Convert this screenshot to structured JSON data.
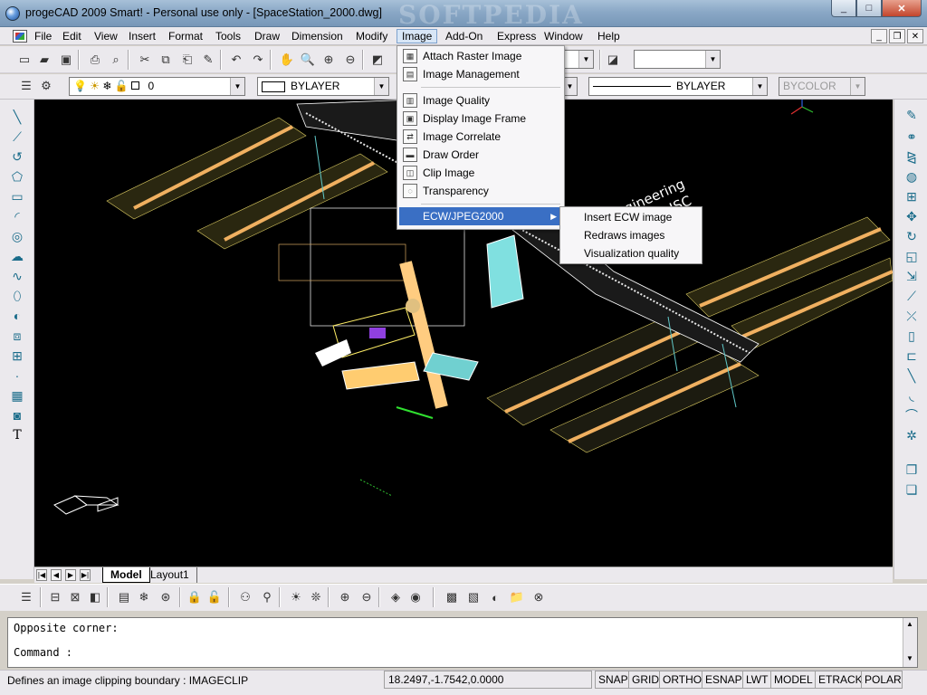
{
  "window": {
    "title": "progeCAD 2009 Smart! - Personal use only - [SpaceStation_2000.dwg]",
    "watermark": "SOFTPEDIA",
    "minimize": "_",
    "maximize": "□",
    "close": "✕"
  },
  "menubar": {
    "items": [
      "File",
      "Edit",
      "View",
      "Insert",
      "Format",
      "Tools",
      "Draw",
      "Dimension",
      "Modify",
      "Image",
      "Add-On",
      "Express",
      "Window",
      "Help"
    ],
    "active": "Image"
  },
  "toolbar2": {
    "layer_value": "0",
    "color_value": "BYLAYER",
    "linetype_value": "BYLAYER",
    "lineweight_value": "BYCOLOR"
  },
  "image_menu": {
    "items": [
      {
        "label": "Attach Raster Image",
        "icon": "attach-raster-icon"
      },
      {
        "label": "Image Management",
        "icon": "image-management-icon"
      },
      {
        "label": "Image Quality",
        "icon": "image-quality-icon"
      },
      {
        "label": "Display Image Frame",
        "icon": "display-frame-icon"
      },
      {
        "label": "Image Correlate",
        "icon": "image-correlate-icon"
      },
      {
        "label": "Draw Order",
        "icon": "draw-order-icon"
      },
      {
        "label": "Clip Image",
        "icon": "clip-image-icon"
      },
      {
        "label": "Transparency",
        "icon": "transparency-icon"
      },
      {
        "label": "ECW/JPEG2000",
        "icon": ""
      }
    ],
    "highlighted": "ECW/JPEG2000"
  },
  "ecw_submenu": {
    "items": [
      "Insert ECW image",
      "Redraws images",
      "Visualization quality"
    ]
  },
  "drawing": {
    "annotation_line1": "ence engineering",
    "annotation_line2": "of NASA JSC"
  },
  "tabs": {
    "model": "Model",
    "layout": "Layout1"
  },
  "command": {
    "line1": "Opposite corner:",
    "line2": "Command :"
  },
  "status": {
    "message": "Defines an image clipping boundary : IMAGECLIP",
    "coordinates": "18.2497,-1.7542,0.0000",
    "toggles": [
      "SNAP",
      "GRID",
      "ORTHO",
      "ESNAP",
      "LWT",
      "MODEL",
      "ETRACK",
      "POLAR"
    ]
  }
}
